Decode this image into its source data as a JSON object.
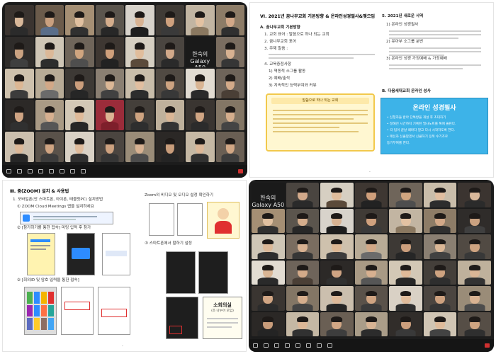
{
  "zoom1": {
    "tiles": [
      {
        "name": "",
        "bg": "#3b3430",
        "skin": "#d9b89a",
        "shirt": "#2b2b2b"
      },
      {
        "name": "",
        "bg": "#6b5b4b",
        "skin": "#c9a07f",
        "shirt": "#5a6e8a"
      },
      {
        "name": "",
        "bg": "#a58f74",
        "skin": "#e0c0a0",
        "shirt": "#303030"
      },
      {
        "name": "",
        "bg": "#5b554d",
        "skin": "#d4ad8c",
        "shirt": "#272727"
      },
      {
        "name": "",
        "bg": "#d8d3cb",
        "skin": "#d8b393",
        "shirt": "#1e1e1e"
      },
      {
        "name": "",
        "bg": "#403b36",
        "skin": "#cfa17e",
        "shirt": "#3a3a3a"
      },
      {
        "name": "",
        "bg": "#c2b5a2",
        "skin": "#e3c2a2",
        "shirt": "#8a7860"
      },
      {
        "name": "",
        "bg": "#8d7c67",
        "skin": "#d2a888",
        "shirt": "#2f2f2f"
      },
      {
        "name": "",
        "bg": "#2f2c2a",
        "skin": "#caa281",
        "shirt": "#3f3f3f"
      },
      {
        "name": "",
        "bg": "#cfc6b6",
        "skin": "#dbb898",
        "shirt": "#2d2d2d"
      },
      {
        "name": "",
        "bg": "#6f655a",
        "skin": "#d0a57f",
        "shirt": "#4e4e4e"
      },
      {
        "name": "",
        "bg": "#3e3732",
        "skin": "#cf9f7b",
        "shirt": "#222222"
      },
      {
        "name": "",
        "bg": "#d6cfc2",
        "skin": "#e0bd9c",
        "shirt": "#5b4a3a"
      },
      {
        "name": "",
        "bg": "#4a4540",
        "skin": "#d2a98a",
        "shirt": "#2a2a2a"
      },
      {
        "name": "",
        "bg": "#1a1a1a",
        "skin": "",
        "shirt": "",
        "label": "한숙의 Galaxy A50"
      },
      {
        "name": "",
        "bg": "#7a6d60",
        "skin": "#d7b191",
        "shirt": "#363636"
      },
      {
        "name": "",
        "bg": "#cec1ad",
        "skin": "#dcb794",
        "shirt": "#3c3c3c"
      },
      {
        "name": "",
        "bg": "#b8ab96",
        "skin": "#d2a887",
        "shirt": "#6b6b6b"
      },
      {
        "name": "",
        "bg": "#3d3935",
        "skin": "#cb9e7c",
        "shirt": "#262626"
      },
      {
        "name": "",
        "bg": "#8a7f72",
        "skin": "#dbb796",
        "shirt": "#414141"
      },
      {
        "name": "",
        "bg": "#c9bdaa",
        "skin": "#e1bea0",
        "shirt": "#2d2d2d"
      },
      {
        "name": "",
        "bg": "#514a43",
        "skin": "#cda381",
        "shirt": "#383838"
      },
      {
        "name": "",
        "bg": "#e2dcd2",
        "skin": "#d9b594",
        "shirt": "#2a2a2a"
      },
      {
        "name": "",
        "bg": "#6e645a",
        "skin": "#d3aa89",
        "shirt": "#4a3f36"
      },
      {
        "name": "",
        "bg": "#2c2927",
        "skin": "#cfa483",
        "shirt": "#303030"
      },
      {
        "name": "",
        "bg": "#a99a85",
        "skin": "#d7b090",
        "shirt": "#565656"
      },
      {
        "name": "",
        "bg": "#d3c8b6",
        "skin": "#dfba99",
        "shirt": "#272727"
      },
      {
        "name": "",
        "bg": "#9b2c3a",
        "skin": "#dcb594",
        "shirt": "#7e1f2b"
      },
      {
        "name": "",
        "bg": "#443f3a",
        "skin": "#cea380",
        "shirt": "#2e2e2e"
      },
      {
        "name": "",
        "bg": "#bfb19c",
        "skin": "#dab696",
        "shirt": "#333333"
      },
      {
        "name": "",
        "bg": "#3a3531",
        "skin": "#d1a684",
        "shirt": "#2b2b2b"
      },
      {
        "name": "",
        "bg": "#837665",
        "skin": "#d5ae8d",
        "shirt": "#444444"
      },
      {
        "name": "",
        "bg": "#cbbfae",
        "skin": "#ddb999",
        "shirt": "#262626"
      },
      {
        "name": "",
        "bg": "#5a524a",
        "skin": "#cfa482",
        "shirt": "#3b3b3b"
      },
      {
        "name": "",
        "bg": "#d9d1c5",
        "skin": "#e0bc9c",
        "shirt": "#2f2f2f"
      },
      {
        "name": "",
        "bg": "#4b4540",
        "skin": "#cda17f",
        "shirt": "#353535"
      },
      {
        "name": "",
        "bg": "#9a8c78",
        "skin": "#d8b292",
        "shirt": "#4c4c4c"
      },
      {
        "name": "",
        "bg": "#2b2826",
        "skin": "#c99d7b",
        "shirt": "#242424"
      },
      {
        "name": "",
        "bg": "#c5b8a4",
        "skin": "#dcb797",
        "shirt": "#313131"
      },
      {
        "name": "",
        "bg": "#6a5f54",
        "skin": "#d2a785",
        "shirt": "#3d3d3d"
      }
    ],
    "toolbar": [
      "",
      "",
      "",
      "",
      "",
      "",
      "",
      "",
      ""
    ]
  },
  "zoom2": {
    "tiles": [
      {
        "name": "",
        "bg": "#1a1a1a",
        "skin": "",
        "shirt": "",
        "label": "한숙의 Galaxy A50"
      },
      {
        "name": "",
        "bg": "#4a4540",
        "skin": "#d2a98a",
        "shirt": "#2a2a2a"
      },
      {
        "name": "",
        "bg": "#d6cfc2",
        "skin": "#e0bd9c",
        "shirt": "#5b4a3a"
      },
      {
        "name": "",
        "bg": "#3e3732",
        "skin": "#cf9f7b",
        "shirt": "#222222"
      },
      {
        "name": "",
        "bg": "#6f655a",
        "skin": "#d0a57f",
        "shirt": "#4e4e4e"
      },
      {
        "name": "",
        "bg": "#c9bdaa",
        "skin": "#e1bea0",
        "shirt": "#2d2d2d"
      },
      {
        "name": "",
        "bg": "#3b3430",
        "skin": "#d9b89a",
        "shirt": "#2b2b2b"
      },
      {
        "name": "",
        "bg": "#a58f74",
        "skin": "#e0c0a0",
        "shirt": "#303030"
      },
      {
        "name": "",
        "bg": "#5b554d",
        "skin": "#d4ad8c",
        "shirt": "#272727"
      },
      {
        "name": "",
        "bg": "#d8d3cb",
        "skin": "#d8b393",
        "shirt": "#1e1e1e"
      },
      {
        "name": "",
        "bg": "#403b36",
        "skin": "#cfa17e",
        "shirt": "#3a3a3a"
      },
      {
        "name": "",
        "bg": "#c2b5a2",
        "skin": "#e3c2a2",
        "shirt": "#8a7860"
      },
      {
        "name": "",
        "bg": "#8d7c67",
        "skin": "#d2a888",
        "shirt": "#2f2f2f"
      },
      {
        "name": "",
        "bg": "#2f2c2a",
        "skin": "#caa281",
        "shirt": "#3f3f3f"
      },
      {
        "name": "",
        "bg": "#cfc6b6",
        "skin": "#dbb898",
        "shirt": "#2d2d2d"
      },
      {
        "name": "",
        "bg": "#7a6d60",
        "skin": "#d7b191",
        "shirt": "#363636"
      },
      {
        "name": "",
        "bg": "#cec1ad",
        "skin": "#dcb794",
        "shirt": "#3c3c3c"
      },
      {
        "name": "",
        "bg": "#b8ab96",
        "skin": "#d2a887",
        "shirt": "#6b6b6b"
      },
      {
        "name": "",
        "bg": "#3d3935",
        "skin": "#cb9e7c",
        "shirt": "#262626"
      },
      {
        "name": "",
        "bg": "#8a7f72",
        "skin": "#dbb796",
        "shirt": "#414141"
      },
      {
        "name": "",
        "bg": "#514a43",
        "skin": "#cda381",
        "shirt": "#383838"
      },
      {
        "name": "",
        "bg": "#e2dcd2",
        "skin": "#d9b594",
        "shirt": "#2a2a2a"
      },
      {
        "name": "",
        "bg": "#6e645a",
        "skin": "#d3aa89",
        "shirt": "#4a3f36"
      },
      {
        "name": "",
        "bg": "#2c2927",
        "skin": "#cfa483",
        "shirt": "#303030"
      },
      {
        "name": "",
        "bg": "#a99a85",
        "skin": "#d7b090",
        "shirt": "#565656"
      },
      {
        "name": "",
        "bg": "#d3c8b6",
        "skin": "#dfba99",
        "shirt": "#272727"
      },
      {
        "name": "",
        "bg": "#443f3a",
        "skin": "#cea380",
        "shirt": "#2e2e2e"
      },
      {
        "name": "",
        "bg": "#bfb19c",
        "skin": "#dab696",
        "shirt": "#333333"
      },
      {
        "name": "",
        "bg": "#3a3531",
        "skin": "#d1a684",
        "shirt": "#2b2b2b"
      },
      {
        "name": "",
        "bg": "#837665",
        "skin": "#d5ae8d",
        "shirt": "#444444"
      },
      {
        "name": "",
        "bg": "#cbbfae",
        "skin": "#ddb999",
        "shirt": "#262626"
      },
      {
        "name": "",
        "bg": "#5a524a",
        "skin": "#cfa482",
        "shirt": "#3b3b3b"
      },
      {
        "name": "",
        "bg": "#d9d1c5",
        "skin": "#e0bc9c",
        "shirt": "#2f2f2f"
      },
      {
        "name": "",
        "bg": "#4b4540",
        "skin": "#cda17f",
        "shirt": "#353535"
      },
      {
        "name": "",
        "bg": "#9a8c78",
        "skin": "#d8b292",
        "shirt": "#4c4c4c"
      },
      {
        "name": "",
        "bg": "#2b2826",
        "skin": "#c99d7b",
        "shirt": "#242424"
      },
      {
        "name": "",
        "bg": "#c5b8a4",
        "skin": "#dcb797",
        "shirt": "#313131"
      },
      {
        "name": "",
        "bg": "#6a5f54",
        "skin": "#d2a785",
        "shirt": "#3d3d3d"
      },
      {
        "name": "",
        "bg": "#aa9d89",
        "skin": "#d8b494",
        "shirt": "#2c2c2c"
      },
      {
        "name": "",
        "bg": "#312d2a",
        "skin": "#cc9f7d",
        "shirt": "#393939"
      },
      {
        "name": "",
        "bg": "#d0c5b4",
        "skin": "#debb9b",
        "shirt": "#434343"
      },
      {
        "name": "",
        "bg": "#564e46",
        "skin": "#cfa481",
        "shirt": "#2f2f2f"
      }
    ],
    "toolbar": [
      "",
      "",
      "",
      "",
      "",
      "",
      "",
      "",
      ""
    ]
  },
  "plan": {
    "title": "VI. 2021년 꿈나무교회 기본방향 & 온라인성경필사&맺으입",
    "a_title": "A. 꿈나무교회 기본방향",
    "a_items": [
      "1. 교회 표어 : 말씀으로 하나 되는 교회",
      "2. 꿈나무교회 표어",
      "3. 주제 말씀 :",
      "4. 교육중점사항"
    ],
    "c_items": [
      "1) 역동적 소그룹 활동",
      "2) 예배/출석",
      "3) 지속적인 능력부여와 커뮤"
    ],
    "notice_head": "말씀으로 하나 되는 교회",
    "right_title": "5. 2021년 새로운 사역",
    "right_items": [
      "1) 온라인 성경필사",
      "2) 유아부 소그룹 분반",
      "3) 온라인 성경 가정예배 & 가정예배"
    ],
    "b_title": "B. 다음세대교회 온라인 성사",
    "bible_title": "온라인 성경필사",
    "bible_lines": [
      "• 신청자들 받아 단톡방을 개설 후 초대하기",
      "• 정해진 시간까지 기록된 필사노트를 톡에 올린다.",
      "• 각 팀이 끝날 때마다 말고 다시 시작하도록 한다.",
      "• 매신자 신클맞겠서 신클하기 응북 수기조로",
      "  등기부여를 한다."
    ],
    "page_num": "-"
  },
  "zoomdoc": {
    "title": "Ⅲ. 줌(ZOOM) 설치 & 사용법",
    "step1": "1. 모바일폰(안 스마트폰, 아이폰, 태블릿PC) 설치방법",
    "step1b": "① ZOOM Cloud Meetings 앱을 설치하세요",
    "step2": "② [참가하기를 통한 접속] 미팅 입력 후 참가",
    "step3": "② [회의ID 및 암호 입력을 통한 접속]",
    "step4": "③ 스마트폰에서 말하기 설정",
    "bubble_text": "소회의실",
    "bubble_sub": "(조 나누어 모임)",
    "right_note": "Zoom의 비디오 및 오디오 설정 확인하기",
    "page_num": "-"
  }
}
